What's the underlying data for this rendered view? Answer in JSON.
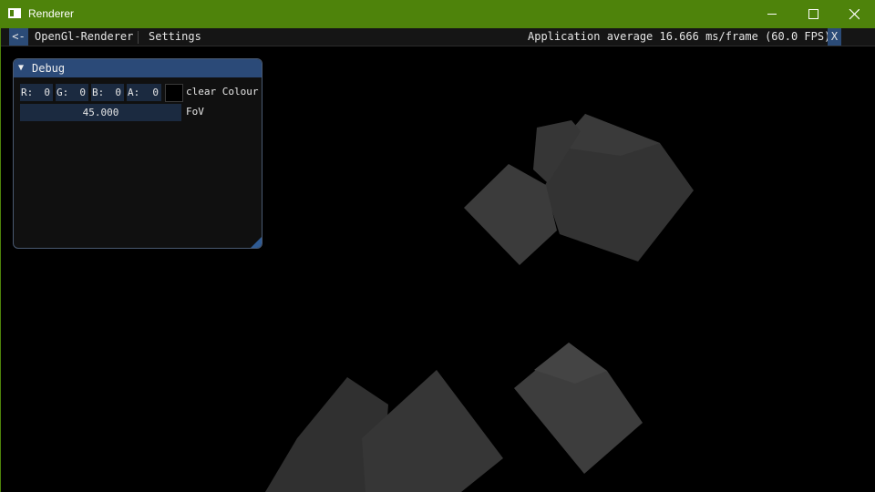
{
  "window": {
    "title": "Renderer",
    "titlebar_color": "#4e830b"
  },
  "menubar": {
    "back_label": "<-",
    "renderer_label": "OpenGl-Renderer",
    "settings_label": "Settings",
    "fps_text": "Application average 16.666 ms/frame (60.0 FPS)",
    "close_label": "X"
  },
  "debug": {
    "title": "Debug",
    "clear_colour": {
      "r_label": "R:",
      "r_value": "0",
      "g_label": "G:",
      "g_value": "0",
      "b_label": "B:",
      "b_value": "0",
      "a_label": "A:",
      "a_value": "0",
      "label": "clear Colour",
      "swatch_color": "#000000"
    },
    "fov": {
      "value": "45.000",
      "label": "FoV"
    }
  },
  "scene": {
    "cube_count": 6,
    "cube_color": "#3a3a3a",
    "background_color": "#000000"
  }
}
